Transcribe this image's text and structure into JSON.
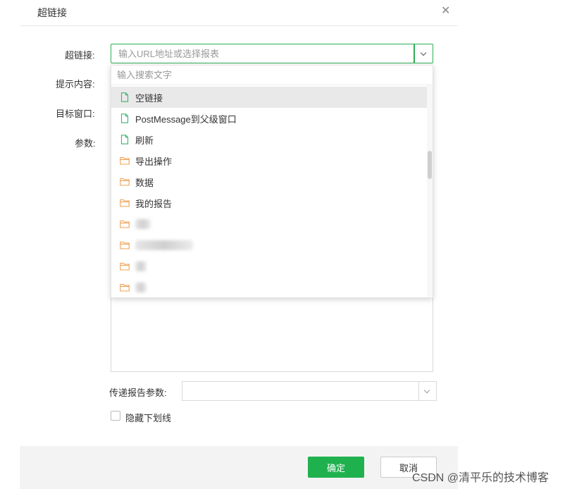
{
  "dialog": {
    "title": "超链接",
    "close_icon": "close-icon"
  },
  "form": {
    "hyperlink_label": "超链接:",
    "hyperlink_placeholder": "输入URL地址或选择报表",
    "tip_label": "提示内容:",
    "target_label": "目标窗口:",
    "params_label": "参数:",
    "pass_params_label": "传递报告参数:",
    "pass_params_value": "",
    "hide_underline_label": "隐藏下划线",
    "hide_underline_checked": false
  },
  "dropdown": {
    "search_placeholder": "输入搜索文字",
    "items": [
      {
        "label": "空链接",
        "icon": "file-icon",
        "selected": true
      },
      {
        "label": "PostMessage到父级窗口",
        "icon": "file-icon",
        "selected": false
      },
      {
        "label": "刷新",
        "icon": "file-icon",
        "selected": false
      },
      {
        "label": "导出操作",
        "icon": "folder-icon",
        "selected": false
      },
      {
        "label": "数据",
        "icon": "folder-icon",
        "selected": false
      },
      {
        "label": "我的报告",
        "icon": "folder-icon",
        "selected": false
      },
      {
        "label": "",
        "icon": "folder-icon",
        "selected": false,
        "redacted": true
      },
      {
        "label": "",
        "icon": "folder-icon",
        "selected": false,
        "redacted": true
      },
      {
        "label": "",
        "icon": "folder-icon",
        "selected": false,
        "redacted": true
      },
      {
        "label": "",
        "icon": "folder-icon",
        "selected": false,
        "redacted": true
      }
    ]
  },
  "footer": {
    "ok_label": "确定",
    "cancel_label": "取消"
  },
  "watermark": "CSDN @清平乐的技术博客",
  "colors": {
    "accent": "#20b14f",
    "input_focus_border": "#2eae55",
    "file_icon": "#3cb371",
    "folder_icon": "#f0a050",
    "selected_row": "#e9e9e9"
  }
}
